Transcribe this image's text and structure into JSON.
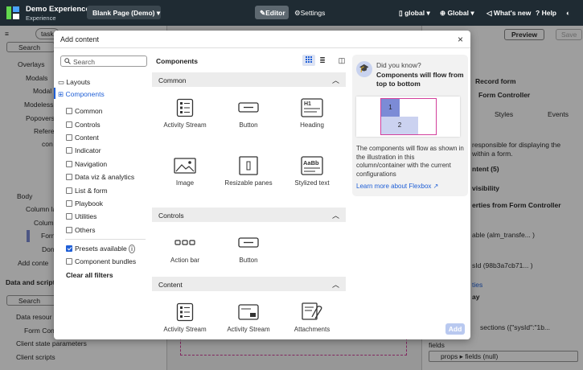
{
  "topbar": {
    "app_title": "Demo Experience",
    "app_subtitle": "Experience",
    "page_selector": "Blank Page (Demo)",
    "editor": "Editor",
    "settings": "Settings",
    "scope1": "global",
    "scope2": "Global",
    "whats_new": "What's new",
    "help": "Help"
  },
  "background": {
    "left_search_tab": "task",
    "left_search": "Search",
    "tree": [
      "Overlays",
      "Modals",
      "Modal",
      "Modeless",
      "Popovers",
      "Refere",
      "con",
      "Body",
      "Column la",
      "Colum",
      "Forn",
      "Don",
      "Add conte"
    ],
    "data_section": "Data and scripts",
    "data_search": "Search",
    "data_items": [
      "Data resour",
      "Form Con",
      "Client state parameters",
      "Client scripts"
    ],
    "preview": "Preview",
    "save": "Save",
    "right_items": [
      "Record form",
      "Form Controller",
      "Styles",
      "Events",
      "responsible for displaying the",
      "within a form.",
      "ntent (5)",
      "visibility",
      "erties from Form Controller",
      "able (alm_transfe... )",
      "sId (98b3a7cb71... )",
      "ties",
      "ay",
      "sections ({\"sysId\":\"1b...",
      "fields",
      "props",
      "fields (null)"
    ]
  },
  "modal": {
    "title": "Add content",
    "close": "×",
    "search_placeholder": "Search",
    "layouts": "Layouts",
    "components": "Components",
    "filters": [
      "Common",
      "Controls",
      "Content",
      "Indicator",
      "Navigation",
      "Data viz & analytics",
      "List & form",
      "Playbook",
      "Utilities",
      "Others"
    ],
    "presets": "Presets available",
    "bundles": "Component bundles",
    "clear": "Clear all filters",
    "components_heading": "Components",
    "sections": [
      {
        "label": "Common",
        "items": [
          "Activity Stream",
          "Button",
          "Heading",
          "Image",
          "Resizable panes",
          "Stylized text"
        ]
      },
      {
        "label": "Controls",
        "items": [
          "Action bar",
          "Button"
        ]
      },
      {
        "label": "Content",
        "items": [
          "Activity Stream",
          "Activity Stream",
          "Attachments"
        ]
      }
    ],
    "tip_heading": "Did you know?",
    "tip_title": "Components will flow from top to bottom",
    "tip_cells": [
      "1",
      "2"
    ],
    "tip_body": "The components will flow as shown in the illustration in this column/container with the current configurations",
    "tip_link": "Learn more about Flexbox",
    "add": "Add",
    "colors": {
      "accent": "#1f5fd6",
      "highlight": "#d23f9b",
      "cell": "#7c8bd6"
    }
  }
}
